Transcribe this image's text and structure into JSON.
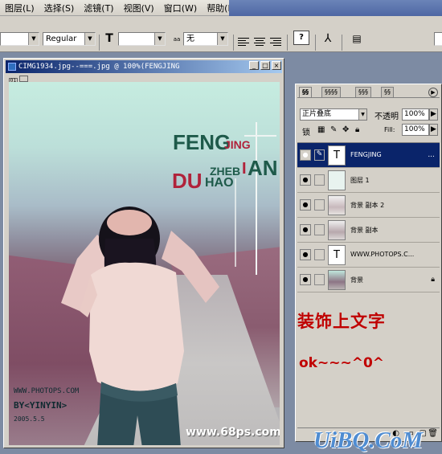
{
  "menu": {
    "items": [
      "图层(L)",
      "选择(S)",
      "滤镜(T)",
      "视图(V)",
      "窗口(W)",
      "帮助(H)"
    ]
  },
  "options_bar": {
    "font_style": "Regular",
    "size_icon": "T",
    "aa_icon": "a",
    "aa_label": "aa",
    "aa_value": "无",
    "warp_label": "?"
  },
  "document": {
    "title": "CIMG1934.jpg--===.jpg @ 100%(FENGJING",
    "ruler_icons": [
      "01",
      ""
    ],
    "photo_text": {
      "logo_line1_big": "FENG",
      "logo_line1_small": "JING",
      "logo_line2_small": "ZHEB",
      "logo_line2_mid": "I",
      "logo_line2_big": "AN",
      "logo_line3_big": "DU",
      "logo_line3_small": "HAO",
      "wm_site": "WWW.PHOTOPS.COM",
      "wm_by": "BY<YINYIN>",
      "wm_date": "2005.5.5",
      "wm_68ps": "www.68ps.com"
    }
  },
  "layers_panel": {
    "tabs": [
      "§§",
      "§§§§",
      "§§§",
      "§§"
    ],
    "blend_mode": "正片叠底",
    "opacity_label": "不透明",
    "opacity_value": "100%",
    "lock_label": "锁",
    "fill_label": "Fill:",
    "fill_value": "100%",
    "layers": [
      {
        "name": "FENGJING",
        "type": "text",
        "thumb": "T",
        "selected": true,
        "extra": "..."
      },
      {
        "name": "图层 1",
        "type": "pixel",
        "thumb": "",
        "selected": false,
        "extra": ""
      },
      {
        "name": "背景 副本 2",
        "type": "pixel",
        "thumb": "",
        "selected": false,
        "extra": ""
      },
      {
        "name": "背景 副本",
        "type": "pixel",
        "thumb": "",
        "selected": false,
        "extra": ""
      },
      {
        "name": "WWW.PHOTOPS.C...",
        "type": "text",
        "thumb": "T",
        "selected": false,
        "extra": ""
      },
      {
        "name": "背景",
        "type": "pixel",
        "thumb": "",
        "selected": false,
        "extra": "locked"
      }
    ]
  },
  "annotations": {
    "line1": "装饰上文字",
    "line2": "ok~~~^0^"
  },
  "site_watermark": "UiBQ.CoM",
  "colors": {
    "logo_green": "#1e5a4a",
    "logo_red": "#b0223a",
    "annotation_red": "#c00000",
    "selection_blue": "#0a246a",
    "watermark_blue": "#4f8cd1"
  }
}
